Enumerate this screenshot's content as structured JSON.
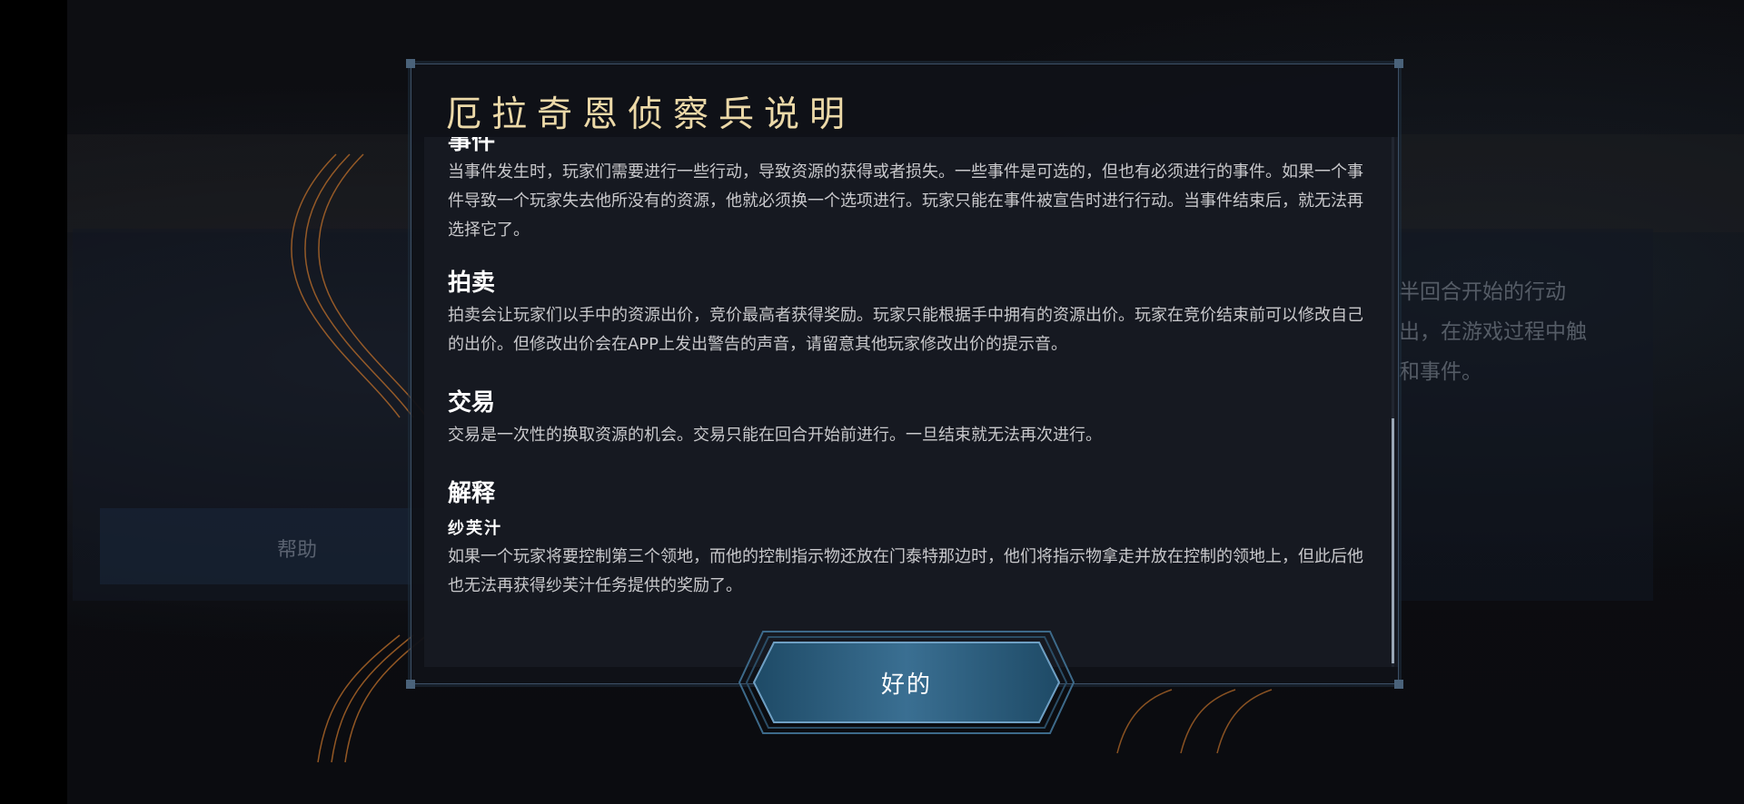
{
  "background": {
    "help_label": "帮助",
    "right_text_lines": [
      "半回合开始的行动",
      "出，在游戏过程中触",
      "和事件。"
    ]
  },
  "dialog": {
    "title": "厄拉奇恩侦察兵说明",
    "sections": [
      {
        "title": "事件",
        "body": "当事件发生时，玩家们需要进行一些行动，导致资源的获得或者损失。一些事件是可选的，但也有必须进行的事件。如果一个事件导致一个玩家失去他所没有的资源，他就必须换一个选项进行。玩家只能在事件被宣告时进行行动。当事件结束后，就无法再选择它了。"
      },
      {
        "title": "拍卖",
        "body": "拍卖会让玩家们以手中的资源出价，竞价最高者获得奖励。玩家只能根据手中拥有的资源出价。玩家在竞价结束前可以修改自己的出价。但修改出价会在APP上发出警告的声音，请留意其他玩家修改出价的提示音。"
      },
      {
        "title": "交易",
        "body": "交易是一次性的换取资源的机会。交易只能在回合开始前进行。一旦结束就无法再次进行。"
      },
      {
        "title": "解释",
        "subtitle": "纱芙汁",
        "body": "如果一个玩家将要控制第三个领地，而他的控制指示物还放在门泰特那边时，他们将指示物拿走并放在控制的领地上，但此后他也无法再获得纱芙汁任务提供的奖励了。"
      }
    ],
    "ok_button": "好的"
  },
  "colors": {
    "title": "#ecd9a8",
    "dialog_border": "#3d5066",
    "button_fill": "#2f5e80",
    "accent_orange": "#c0702a"
  },
  "icons": [
    "scrollbar"
  ]
}
